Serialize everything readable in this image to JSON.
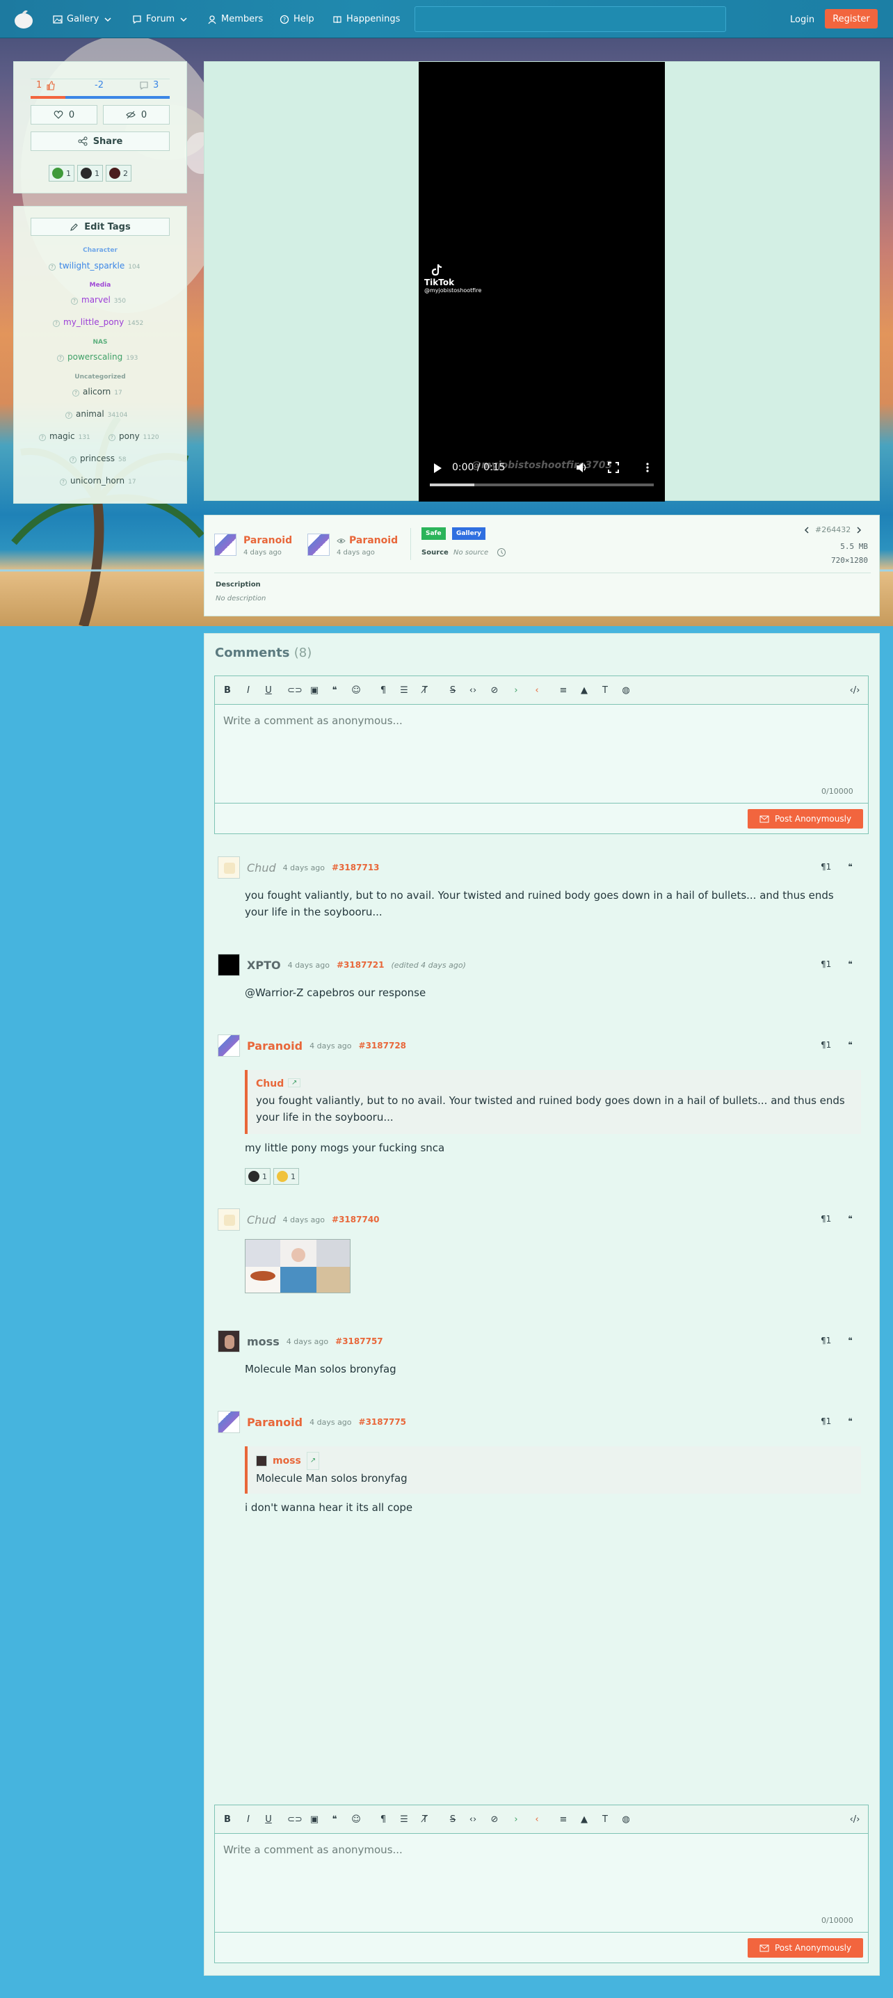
{
  "nav": {
    "items": [
      {
        "label": "Gallery",
        "icon": "image-icon",
        "has_dropdown": true
      },
      {
        "label": "Forum",
        "icon": "chat-icon",
        "has_dropdown": true
      },
      {
        "label": "Members",
        "icon": "user-icon",
        "has_dropdown": false
      },
      {
        "label": "Help",
        "icon": "help-circle-icon",
        "has_dropdown": false
      },
      {
        "label": "Happenings",
        "icon": "book-icon",
        "has_dropdown": false
      }
    ],
    "login": "Login",
    "register": "Register"
  },
  "colors": {
    "accent": "#f2653e",
    "link": "#e8673a",
    "panel": "#ebf7f2",
    "safe": "#2bb45a",
    "gallery": "#2f6fe0",
    "character": "#3b86e6",
    "media": "#9b3dd6",
    "nas": "#3fa067"
  },
  "image_stats": {
    "upvotes": "1",
    "score": "-2",
    "comments": "3",
    "faves": "0",
    "hides": "0",
    "share": "Share",
    "reactions": [
      {
        "count": "1"
      },
      {
        "count": "1"
      },
      {
        "count": "2"
      }
    ]
  },
  "tags": {
    "edit": "Edit Tags",
    "groups": [
      {
        "category": "Character",
        "items": [
          {
            "name": "twilight_sparkle",
            "count": "104"
          }
        ]
      },
      {
        "category": "Media",
        "items": [
          {
            "name": "marvel",
            "count": "350"
          },
          {
            "name": "my_little_pony",
            "count": "1452"
          }
        ]
      },
      {
        "category": "NAS",
        "items": [
          {
            "name": "powerscaling",
            "count": "193"
          }
        ]
      },
      {
        "category": "Uncategorized",
        "items": [
          {
            "name": "alicorn",
            "count": "17"
          },
          {
            "name": "animal",
            "count": "34104"
          },
          {
            "name": "magic",
            "count": "131"
          },
          {
            "name": "pony",
            "count": "1120"
          },
          {
            "name": "princess",
            "count": "58"
          },
          {
            "name": "unicorn_horn",
            "count": "17"
          }
        ]
      }
    ]
  },
  "video": {
    "brand": "TikTok",
    "handle": "@myjobistoshootfire",
    "watermark": "@myjobistoshootfire3703",
    "time": "0:00 / 0:15",
    "progress": 0.2
  },
  "image_info": {
    "uploader": "Paranoid",
    "uploaded": "4 days ago",
    "artist": "Paranoid",
    "artist_time": "4 days ago",
    "badge_safe": "Safe",
    "badge_gallery": "Gallery",
    "source_label": "Source",
    "source_value": "No source",
    "id": "#264432",
    "size": "5.5 MB",
    "dims": "720×1280",
    "description_label": "Description",
    "description_value": "No description"
  },
  "comments": {
    "title": "Comments",
    "count": "(8)",
    "placeholder": "Write a comment as anonymous...",
    "char_count": "0/10000",
    "post_label": "Post Anonymously",
    "items": [
      {
        "name": "Chud",
        "time": "4 days ago",
        "id": "#3187713",
        "text": "you fought valiantly, but to no avail. Your twisted and ruined body goes down in a hail of bullets... and thus ends your life in the soybooru..."
      },
      {
        "name": "XPTO",
        "time": "4 days ago",
        "id": "#3187721",
        "edited": "(edited 4 days ago)",
        "text": "@Warrior-Z capebros our response"
      },
      {
        "name": "Paranoid",
        "time": "4 days ago",
        "id": "#3187728",
        "quote_author": "Chud",
        "quote_text": "you fought valiantly, but to no avail. Your twisted and ruined body goes down in a hail of bullets... and thus ends your life in the soybooru...",
        "text": "my little pony mogs your fucking snca",
        "reactions": [
          {
            "count": "1"
          },
          {
            "count": "1"
          }
        ]
      },
      {
        "name": "Chud",
        "time": "4 days ago",
        "id": "#3187740"
      },
      {
        "name": "moss",
        "time": "4 days ago",
        "id": "#3187757",
        "text": "Molecule Man solos bronyfag"
      },
      {
        "name": "Paranoid",
        "time": "4 days ago",
        "id": "#3187775",
        "quote_author": "moss",
        "quote_text": "Molecule Man solos bronyfag",
        "text": "i don't wanna hear it its all cope"
      }
    ]
  }
}
